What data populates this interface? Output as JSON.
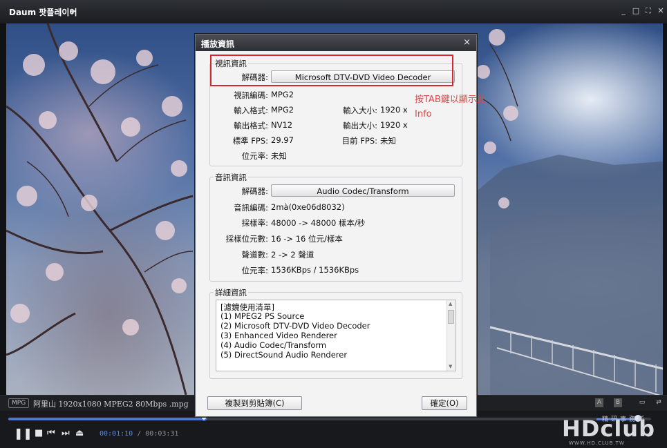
{
  "window": {
    "title": "Daum 팟플레이어",
    "controls": [
      "_",
      "□",
      "⛶",
      "✕"
    ]
  },
  "file_info": {
    "format_badge": "MPG",
    "filename": "阿里山 1920x1080 MPEG2 80Mbps .mpg"
  },
  "playback": {
    "elapsed": "00:01:10",
    "separator": "/",
    "total": "00:03:31",
    "progress_fraction": 0.304,
    "volume_fraction": 0.93
  },
  "watermark": {
    "logo": "HDclub",
    "tagline": "精研事務所",
    "url": "WWW.HD.CLUB.TW"
  },
  "dialog": {
    "title": "播放資訊",
    "close": "×",
    "video_section": {
      "legend": "視訊資訊",
      "decoder_label": "解碼器:",
      "decoder_value": "Microsoft DTV-DVD Video Decoder",
      "rows": [
        {
          "label": "視訊編碼:",
          "value": "MPG2"
        },
        {
          "label": "輸入格式:",
          "value": "MPG2",
          "label2": "輸入大小:",
          "value2": "1920 x"
        },
        {
          "label": "輸出格式:",
          "value": "NV12",
          "label2": "輸出大小:",
          "value2": "1920 x"
        },
        {
          "label": "標準 FPS:",
          "value": "29.97",
          "label2": "目前 FPS:",
          "value2": "未知"
        },
        {
          "label": "位元率:",
          "value": "未知"
        }
      ]
    },
    "audio_section": {
      "legend": "音訊資訊",
      "decoder_label": "解碼器:",
      "decoder_value": "Audio Codec/Transform",
      "rows": [
        {
          "label": "音訊編碼:",
          "value": "2mà(0xe06d8032)"
        },
        {
          "label": "採樣率:",
          "value": "48000 -> 48000 樣本/秒"
        },
        {
          "label": "採樣位元數:",
          "value": "16 -> 16 位元/樣本"
        },
        {
          "label": "聲道數:",
          "value": "2 -> 2 聲道"
        },
        {
          "label": "位元率:",
          "value": "1536KBps / 1536KBps"
        }
      ]
    },
    "detail_section": {
      "legend": "詳細資訊",
      "lines": [
        "[濾鏡使用清單]",
        "(1) MPEG2 PS Source",
        "(2) Microsoft DTV-DVD Video Decoder",
        "(3) Enhanced Video Renderer",
        "(4) Audio Codec/Transform",
        "(5) DirectSound Audio Renderer"
      ]
    },
    "copy_button": "複製到剪貼簿(C)",
    "ok_button": "確定(O)"
  },
  "annotation": {
    "line1": "按TAB鍵以顯示此",
    "line2": "Info",
    "color": "#d8262f"
  }
}
